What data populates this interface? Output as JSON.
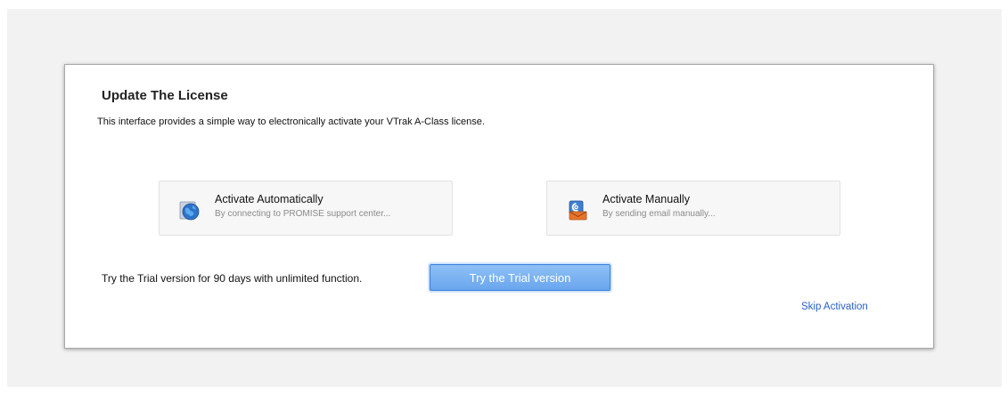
{
  "dialog": {
    "title": "Update The License",
    "description": "This interface provides a simple way to electronically activate your VTrak A-Class license."
  },
  "options": {
    "automatic": {
      "title": "Activate Automatically",
      "subtitle": "By connecting to PROMISE support center...",
      "icon": "globe-icon"
    },
    "manual": {
      "title": "Activate Manually",
      "subtitle": "By sending email manually...",
      "icon": "email-icon"
    }
  },
  "trial": {
    "text": "Try the Trial version for 90 days with unlimited function.",
    "button_label": "Try the Trial version"
  },
  "skip": {
    "label": "Skip Activation"
  },
  "colors": {
    "accent": "#6aa6ee",
    "link": "#2a62c9"
  }
}
